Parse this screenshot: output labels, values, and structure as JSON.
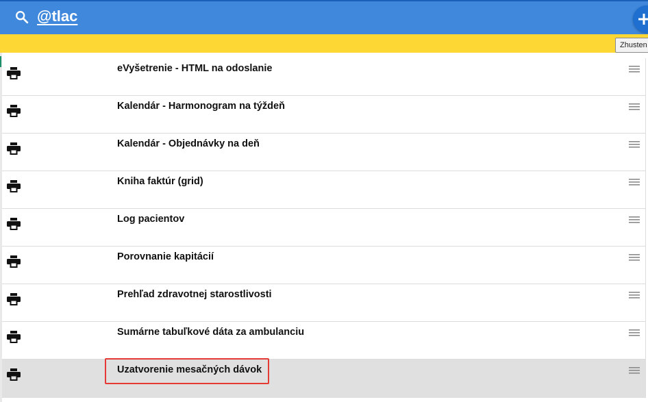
{
  "search": {
    "query": "@tlac",
    "icon": "search-icon"
  },
  "toolbar": {
    "add_icon": "plus-icon",
    "condense_label": "Zhusten"
  },
  "colors": {
    "topbar": "#3f88dc",
    "yellowbar": "#fdd835",
    "selected_row": "#e0e0e0",
    "highlight_border": "#e53935"
  },
  "list": {
    "items": [
      {
        "label": "eVyšetrenie - HTML na odoslanie",
        "icon": "print-icon",
        "selected": false
      },
      {
        "label": "Kalendár - Harmonogram na týždeň",
        "icon": "print-icon",
        "selected": false
      },
      {
        "label": "Kalendár - Objednávky na deň",
        "icon": "print-icon",
        "selected": false
      },
      {
        "label": "Kniha faktúr (grid)",
        "icon": "print-icon",
        "selected": false
      },
      {
        "label": "Log pacientov",
        "icon": "print-icon",
        "selected": false
      },
      {
        "label": "Porovnanie kapitácií",
        "icon": "print-icon",
        "selected": false
      },
      {
        "label": "Prehľad zdravotnej starostlivosti",
        "icon": "print-icon",
        "selected": false
      },
      {
        "label": "Sumárne tabuľkové dáta za ambulanciu",
        "icon": "print-icon",
        "selected": false
      },
      {
        "label": "Uzatvorenie mesačných dávok",
        "icon": "print-icon",
        "selected": true
      }
    ]
  }
}
